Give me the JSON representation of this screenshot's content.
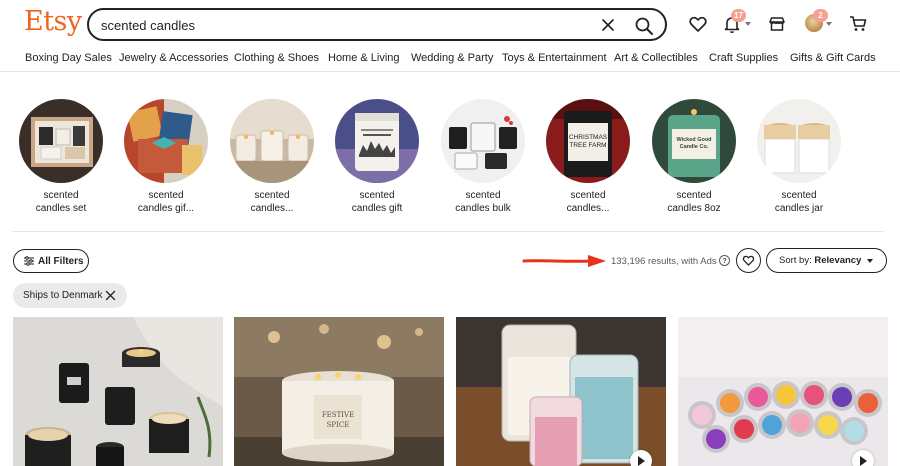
{
  "brand": {
    "logo": "Etsy",
    "accent": "#f1641e"
  },
  "search": {
    "value": "scented candles",
    "clear_icon": "close-icon",
    "submit_icon": "search-icon"
  },
  "header_icons": {
    "favorites_icon": "heart-icon",
    "notifications": {
      "icon": "bell-icon",
      "count": "17"
    },
    "shop_icon": "shop-icon",
    "account": {
      "icon": "avatar",
      "count": "2"
    },
    "cart_icon": "cart-icon"
  },
  "nav": {
    "items": [
      "Boxing Day Sales",
      "Jewelry & Accessories",
      "Clothing & Shoes",
      "Home & Living",
      "Wedding & Party",
      "Toys & Entertainment",
      "Art & Collectibles",
      "Craft Supplies",
      "Gifts & Gift Cards"
    ]
  },
  "related_searches": [
    {
      "line1": "scented",
      "line2": "candles set"
    },
    {
      "line1": "scented",
      "line2": "candles gif..."
    },
    {
      "line1": "scented",
      "line2": "candles..."
    },
    {
      "line1": "scented",
      "line2": "candles gift"
    },
    {
      "line1": "scented",
      "line2": "candles bulk"
    },
    {
      "line1": "scented",
      "line2": "candles..."
    },
    {
      "line1": "scented",
      "line2": "candles 8oz"
    },
    {
      "line1": "scented",
      "line2": "candles jar"
    }
  ],
  "thumb_text": {
    "christmas_1": "CHRISTMAS",
    "christmas_2": "TREE FARM",
    "wicked_good_1": "Wicked Good",
    "wicked_good_2": "Candle Co.",
    "festive_1": "FESTIVE",
    "festive_2": "SPICE"
  },
  "filters": {
    "all_filters_label": "All Filters",
    "results_text": "133,196 results, with Ads",
    "help_icon": "?",
    "sort_prefix": "Sort by: ",
    "sort_value": "Relevancy",
    "active_chip": "Ships to Denmark"
  },
  "annotation": {
    "arrow_color": "#e8331c"
  },
  "products": [
    {
      "icon": "product-image",
      "video": false
    },
    {
      "icon": "product-image",
      "video": false
    },
    {
      "icon": "product-image",
      "video": true
    },
    {
      "icon": "product-image",
      "video": true
    }
  ]
}
